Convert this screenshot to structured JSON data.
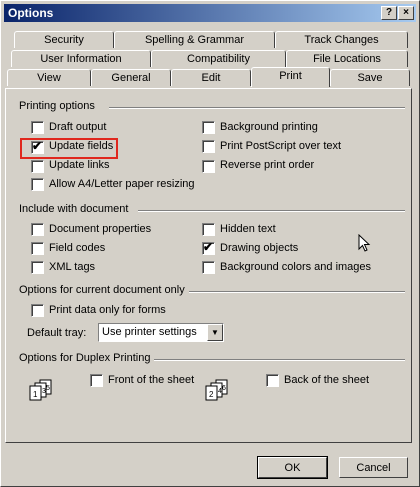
{
  "window": {
    "title": "Options",
    "help_label": "?",
    "close_label": "×"
  },
  "tabs": {
    "row1": [
      "Security",
      "Spelling & Grammar",
      "Track Changes"
    ],
    "row2": [
      "User Information",
      "Compatibility",
      "File Locations"
    ],
    "row3": [
      "View",
      "General",
      "Edit",
      "Print",
      "Save"
    ],
    "active": "Print"
  },
  "printing_options": {
    "title": "Printing options",
    "items": [
      {
        "label": "Draft output",
        "checked": false
      },
      {
        "label": "Update fields",
        "checked": true
      },
      {
        "label": "Update links",
        "checked": false
      },
      {
        "label": "Allow A4/Letter paper resizing",
        "checked": false
      },
      {
        "label": "Background printing",
        "checked": false
      },
      {
        "label": "Print PostScript over text",
        "checked": false
      },
      {
        "label": "Reverse print order",
        "checked": false
      }
    ]
  },
  "include_with_document": {
    "title": "Include with document",
    "items": [
      {
        "label": "Document properties",
        "checked": false
      },
      {
        "label": "Field codes",
        "checked": false
      },
      {
        "label": "XML tags",
        "checked": false
      },
      {
        "label": "Hidden text",
        "checked": false
      },
      {
        "label": "Drawing objects",
        "checked": true
      },
      {
        "label": "Background colors and images",
        "checked": false
      }
    ]
  },
  "current_document": {
    "title": "Options for current document only",
    "items": [
      {
        "label": "Print data only for forms",
        "checked": false
      }
    ],
    "tray_label": "Default tray:",
    "tray_value": "Use printer settings"
  },
  "duplex": {
    "title": "Options for Duplex Printing",
    "items": [
      {
        "label": "Front of the sheet",
        "checked": false
      },
      {
        "label": "Back of the sheet",
        "checked": false
      }
    ],
    "front_pages": [
      "1",
      "3",
      "5"
    ],
    "back_pages": [
      "2",
      "4",
      "6"
    ]
  },
  "buttons": {
    "ok": "OK",
    "cancel": "Cancel"
  },
  "colors": {
    "titlebar_start": "#0a246a",
    "titlebar_end": "#a6caf0",
    "highlight": "#e0281e"
  }
}
